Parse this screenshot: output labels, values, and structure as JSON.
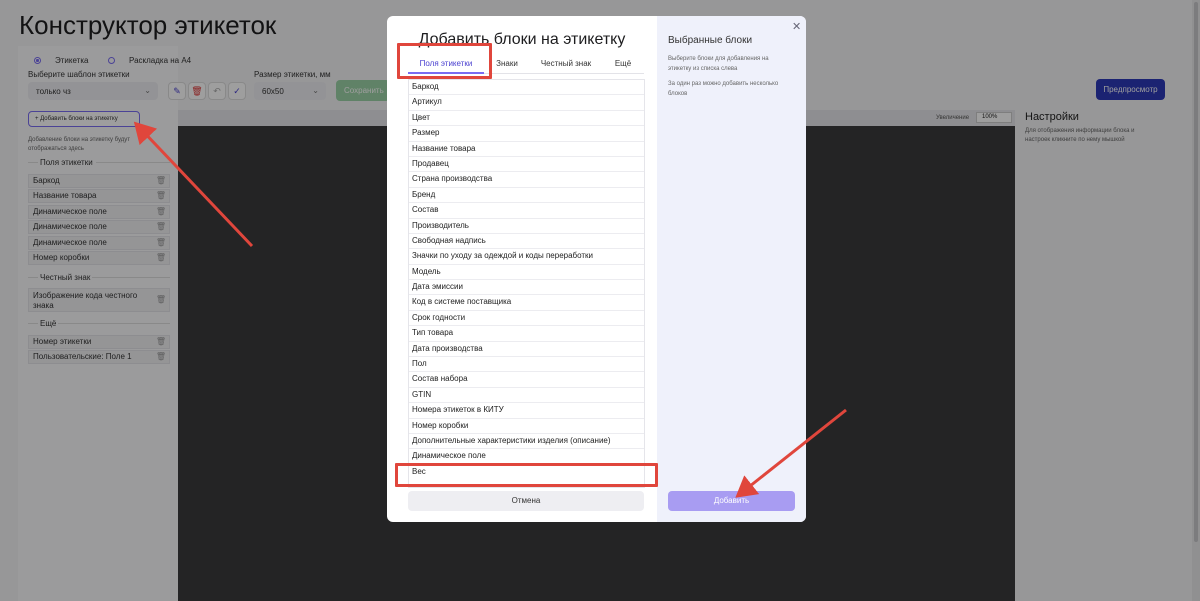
{
  "app": {
    "title": "Конструктор этикеток",
    "mode_options": [
      "Этикетка",
      "Раскладка на А4"
    ],
    "template_label": "Выберите шаблон этикетки",
    "template_value": "только чз",
    "size_label": "Размер этикетки, мм",
    "size_value": "60х50",
    "save_label": "Сохранить",
    "preview_label": "Предпросмотр",
    "add_blocks_label": "Добавить блоки на этикетку",
    "hint": "Добавление блоки на этикетку будут отображаться здесь",
    "groups": [
      {
        "title": "Поля этикетки",
        "items": [
          "Баркод",
          "Название товара",
          "Динамическое поле",
          "Динамическое поле",
          "Динамическое поле",
          "Номер коробки"
        ]
      },
      {
        "title": "Честный знак",
        "items": [
          "Изображение кода честного знака"
        ]
      },
      {
        "title": "Ещё",
        "items": [
          "Номер этикетки",
          "Пользовательские: Поле 1"
        ]
      }
    ],
    "zoom_label": "Увеличение",
    "zoom_value": "100%",
    "settings_title": "Настройки",
    "settings_hint": "Для отображения информации блока и настроек кликните по нему мышкой"
  },
  "modal": {
    "title": "Добавить блоки на этикетку",
    "tabs": [
      "Поля этикетки",
      "Знаки",
      "Честный знак",
      "Ещё"
    ],
    "active_tab": "Поля этикетки",
    "items": [
      "Баркод",
      "Артикул",
      "Цвет",
      "Размер",
      "Название товара",
      "Продавец",
      "Страна производства",
      "Бренд",
      "Состав",
      "Производитель",
      "Свободная надпись",
      "Значки по уходу за одеждой и коды переработки",
      "Модель",
      "Дата эмиссии",
      "Код в системе поставщика",
      "Срок годности",
      "Тип товара",
      "Дата производства",
      "Пол",
      "Состав набора",
      "GTIN",
      "Номера этикеток в КИТУ",
      "Номер коробки",
      "Дополнительные характеристики изделия (описание)",
      "Динамическое поле",
      "Вес"
    ],
    "cancel_label": "Отмена",
    "selected_title": "Выбранные блоки",
    "selected_desc_1": "Выберите блоки для добавления на этикетку из списка слева",
    "selected_desc_2": "За один раз можно добавить несколько блоков",
    "add_label": "Добавить"
  },
  "colors": {
    "accent": "#7a6cf2",
    "annotation": "#e0463c",
    "preview": "#2c39b8",
    "save": "#9bd2a6"
  }
}
